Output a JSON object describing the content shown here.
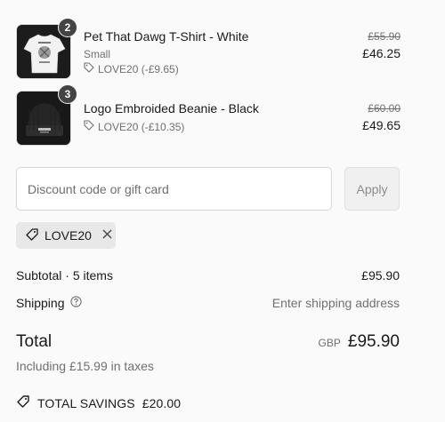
{
  "items": [
    {
      "quantity": "2",
      "title": "Pet That Dawg T-Shirt - White",
      "variant": "Small",
      "discount": "LOVE20 (-£9.65)",
      "original_price": "£55.90",
      "price": "£46.25",
      "image_icon": "white-tshirt-image"
    },
    {
      "quantity": "3",
      "title": "Logo Embroided Beanie - Black",
      "variant": "",
      "discount": "LOVE20 (-£10.35)",
      "original_price": "£60.00",
      "price": "£49.65",
      "image_icon": "black-beanie-image"
    }
  ],
  "discount_field": {
    "placeholder": "Discount code or gift card",
    "value": "",
    "apply_label": "Apply"
  },
  "applied_code": {
    "label": "LOVE20",
    "remove_icon": "close-icon"
  },
  "summary": {
    "subtotal_label": "Subtotal · 5 items",
    "subtotal_value": "£95.90",
    "shipping_label": "Shipping",
    "shipping_value": "Enter shipping address",
    "total_label": "Total",
    "currency": "GBP",
    "total_value": "£95.90",
    "taxes_note": "Including £15.99 in taxes",
    "savings_label": "TOTAL SAVINGS",
    "savings_value": "£20.00"
  },
  "colors": {
    "background": "#fafafa",
    "text": "#1a1a1a",
    "muted": "#707070",
    "chip": "#e8e8e8",
    "badge": "#444444"
  }
}
